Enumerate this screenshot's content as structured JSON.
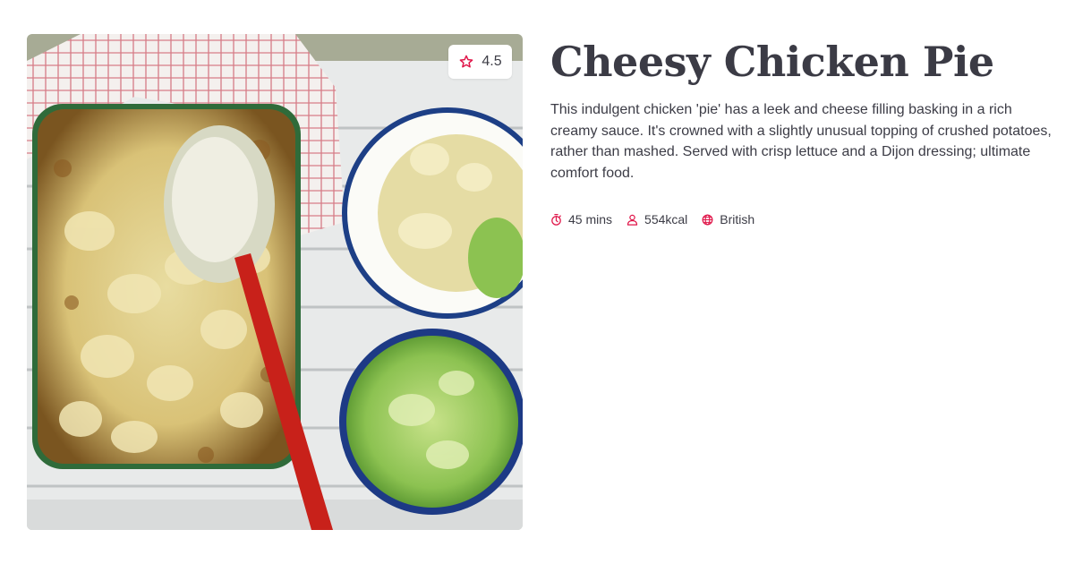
{
  "recipe": {
    "title": "Cheesy Chicken Pie",
    "description": "This indulgent chicken 'pie' has a leek and cheese filling basking in a rich creamy sauce. It's crowned with a slightly unusual topping of crushed potatoes, rather than mashed. Served with crisp lettuce and a Dijon dressing; ultimate comfort food.",
    "rating": "4.5",
    "image_icon": "food-photo",
    "meta": {
      "time": "45 mins",
      "calories": "554kcal",
      "cuisine": "British"
    }
  },
  "icons": {
    "rating": "star-icon",
    "time": "timer-icon",
    "calories": "person-icon",
    "cuisine": "globe-icon"
  },
  "colors": {
    "accent": "#e0174a",
    "text": "#3c3c46",
    "background": "#ffffff"
  }
}
